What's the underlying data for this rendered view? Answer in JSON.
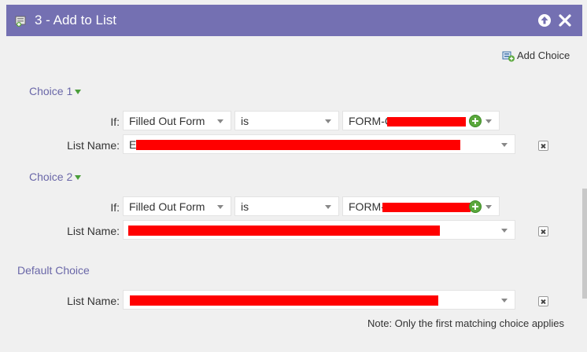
{
  "dialog": {
    "title": "3 - Add to List",
    "title_icon": "list-add-icon",
    "up_icon": "arrow-up-circle-icon",
    "close_icon": "close-icon",
    "accent_color": "#7470b2"
  },
  "toolbar": {
    "add_choice_label": "Add Choice",
    "add_choice_icon": "add-choice-icon"
  },
  "labels": {
    "if": "If:",
    "list_name": "List Name:"
  },
  "choices": [
    {
      "title": "Choice 1",
      "condition_field": "Filled Out Form",
      "operator": "is",
      "form_value_prefix": "FORM-C",
      "list_name_prefix": "E"
    },
    {
      "title": "Choice 2",
      "condition_field": "Filled Out Form",
      "operator": "is",
      "form_value_prefix": "FORM-",
      "list_name_prefix": ""
    }
  ],
  "default_choice": {
    "title": "Default Choice",
    "list_name_prefix": ""
  },
  "note": "Note: Only the first matching choice applies",
  "colors": {
    "redaction": "#ff0000",
    "heading": "#6a67a8"
  }
}
